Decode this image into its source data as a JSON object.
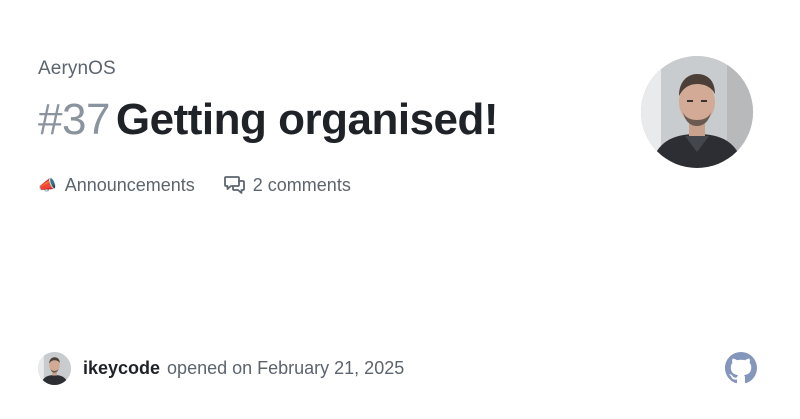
{
  "repo": {
    "name": "AerynOS"
  },
  "issue": {
    "number": "#37",
    "title": "Getting organised!"
  },
  "meta": {
    "category_emoji": "📣",
    "category": "Announcements",
    "comments": "2 comments"
  },
  "author": {
    "username": "ikeycode",
    "action": "opened on February 21, 2025"
  },
  "icons": {
    "comments": "comment-discussion-icon",
    "brand": "github-mark-icon"
  },
  "colors": {
    "title": "#1f2328",
    "muted": "#5c646e",
    "number": "#8b949e",
    "github_logo": "#8596bd"
  }
}
